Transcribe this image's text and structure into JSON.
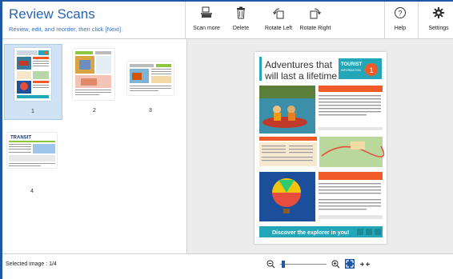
{
  "header": {
    "title": "Review Scans",
    "subtitle": "Review, edit, and reorder, then click [Next]."
  },
  "toolbar": {
    "scan_more": "Scan more",
    "delete": "Delete",
    "rotate_left": "Rotate Left",
    "rotate_right": "Rotate Right",
    "help": "Help",
    "settings": "Settings"
  },
  "thumbnails": [
    {
      "number": "1",
      "selected": true
    },
    {
      "number": "2",
      "selected": false
    },
    {
      "number": "3",
      "selected": false
    },
    {
      "number": "4",
      "selected": false
    }
  ],
  "preview": {
    "headline_line1": "Adventures that",
    "headline_line2": "will last a lifetime",
    "badge_line1": "TOURIST",
    "badge_line2": "INFORMATION",
    "badge_number": "1",
    "footer_banner": "Discover the explorer in you!"
  },
  "thumb_texts": {
    "transit": "TRANSIT"
  },
  "status": {
    "selected_image": "Selected image : 1/4"
  },
  "colors": {
    "accent": "#1f57a4",
    "title": "#2b63b3",
    "selection": "#cfe3f5",
    "preview_bg": "#ececec",
    "banner_teal": "#23a7b8",
    "banner_orange": "#f05a28"
  }
}
